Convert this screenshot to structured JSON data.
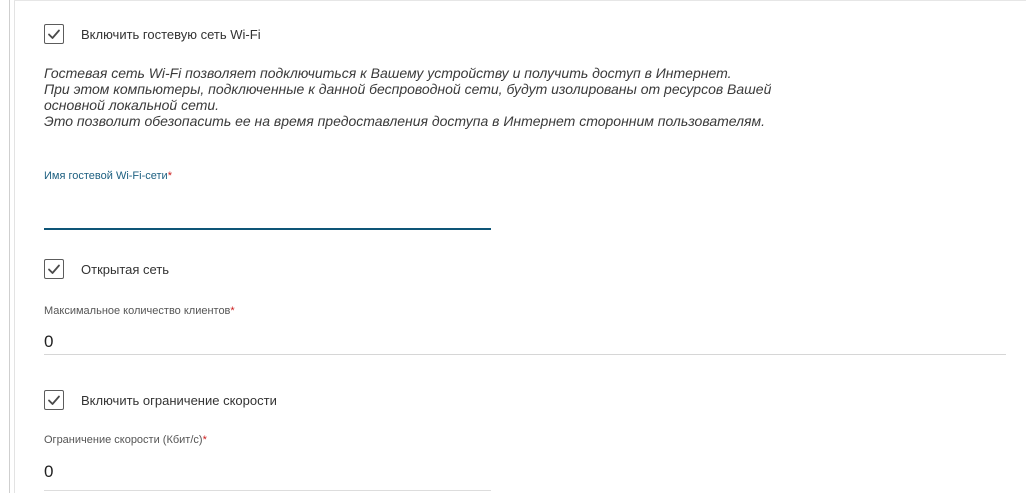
{
  "guest_wifi": {
    "enable_label": "Включить гостевую сеть Wi-Fi",
    "enable_checked": true,
    "description_lines": [
      "Гостевая сеть Wi-Fi позволяет подключиться к Вашему устройству и получить доступ в Интернет.",
      "При этом компьютеры, подключенные к данной беспроводной сети, будут изолированы от ресурсов Вашей",
      "основной локальной сети.",
      "Это позволит обезопасить ее на время предоставления доступа в Интернет сторонним пользователям."
    ],
    "ssid_label": "Имя гостевой Wi-Fi-сети",
    "ssid_value": "",
    "open_network_label": "Открытая сеть",
    "open_network_checked": true,
    "max_clients_label": "Максимальное количество клиентов",
    "max_clients_value": "0",
    "speed_limit_enable_label": "Включить ограничение скорости",
    "speed_limit_enable_checked": true,
    "speed_limit_label": "Ограничение скорости (Кбит/с)",
    "speed_limit_value": "0",
    "required_mark": "*"
  },
  "colors": {
    "accent": "#0e5577",
    "required": "#cc1d1d",
    "checkbox_border": "#5c5c5c"
  }
}
